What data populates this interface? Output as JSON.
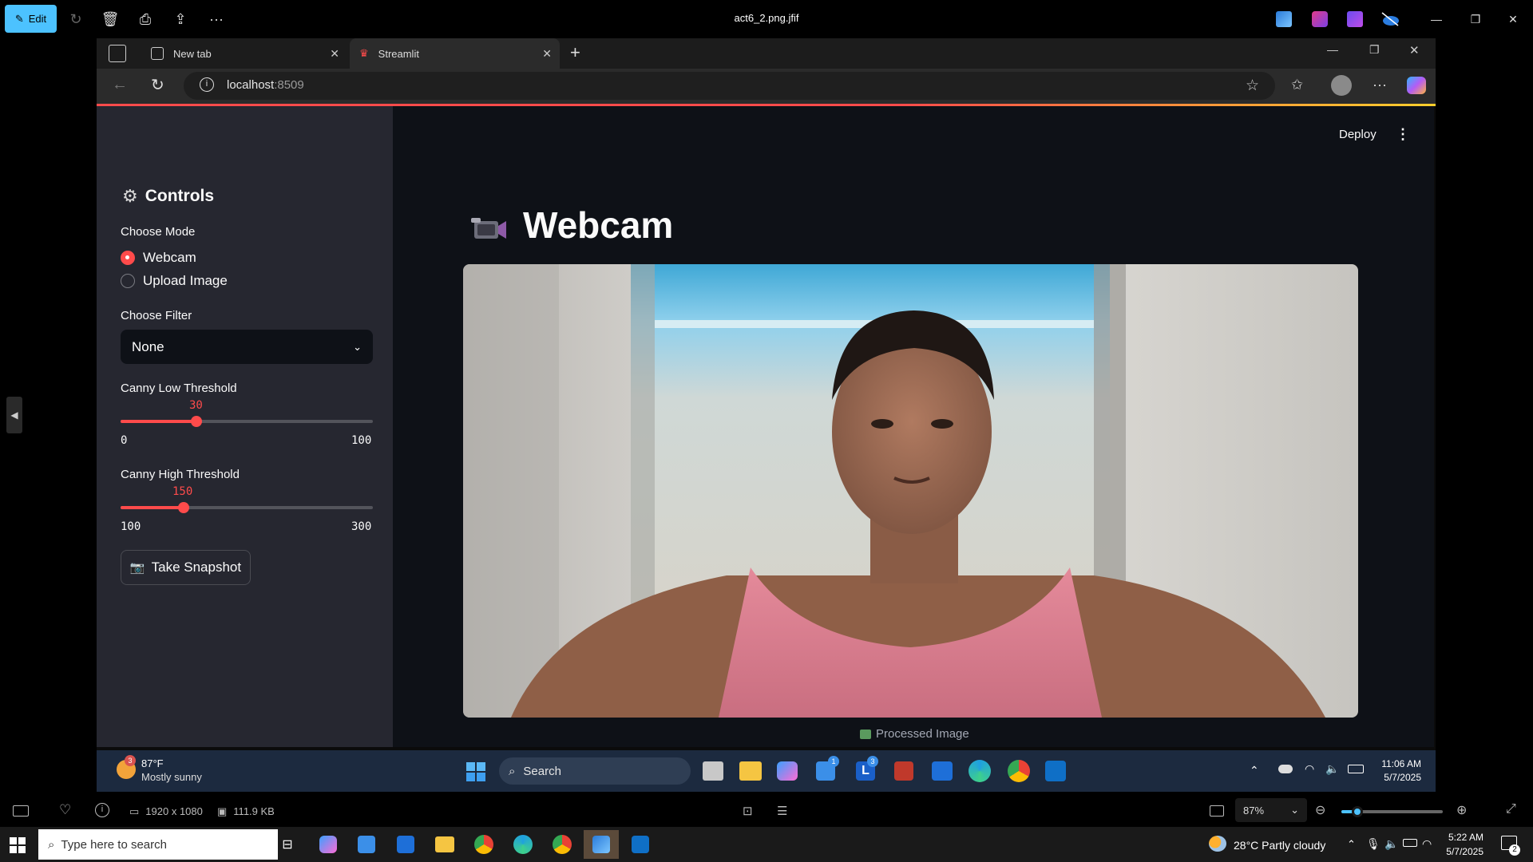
{
  "photos_app": {
    "edit_label": "Edit",
    "file_title": "act6_2.png.jfif",
    "image_dimensions": "1920 x 1080",
    "file_size": "111.9 KB",
    "zoom_level": "87%"
  },
  "browser": {
    "tabs": [
      {
        "label": "New tab"
      },
      {
        "label": "Streamlit"
      }
    ],
    "url_host": "localhost",
    "url_port": ":8509"
  },
  "streamlit": {
    "deploy_label": "Deploy",
    "sidebar": {
      "title": "Controls",
      "mode_label": "Choose Mode",
      "mode_options": [
        "Webcam",
        "Upload Image"
      ],
      "mode_selected": "Webcam",
      "filter_label": "Choose Filter",
      "filter_value": "None",
      "low_threshold": {
        "label": "Canny Low Threshold",
        "value": "30",
        "min": "0",
        "max": "100",
        "fraction": 0.3
      },
      "high_threshold": {
        "label": "Canny High Threshold",
        "value": "150",
        "min": "100",
        "max": "300",
        "fraction": 0.25
      },
      "snapshot_label": "Take Snapshot"
    },
    "main": {
      "title": "Webcam",
      "caption": "Processed Image"
    }
  },
  "inner_taskbar": {
    "weather_temp": "87°F",
    "weather_desc": "Mostly sunny",
    "weather_badge": "3",
    "search_label": "Search",
    "store_badge": "1",
    "lens_badge": "3",
    "time": "11:06 AM",
    "date": "5/7/2025"
  },
  "taskbar": {
    "search_placeholder": "Type here to search",
    "weather": "28°C  Partly cloudy",
    "time": "5:22 AM",
    "date": "5/7/2025",
    "notification_count": "2"
  }
}
